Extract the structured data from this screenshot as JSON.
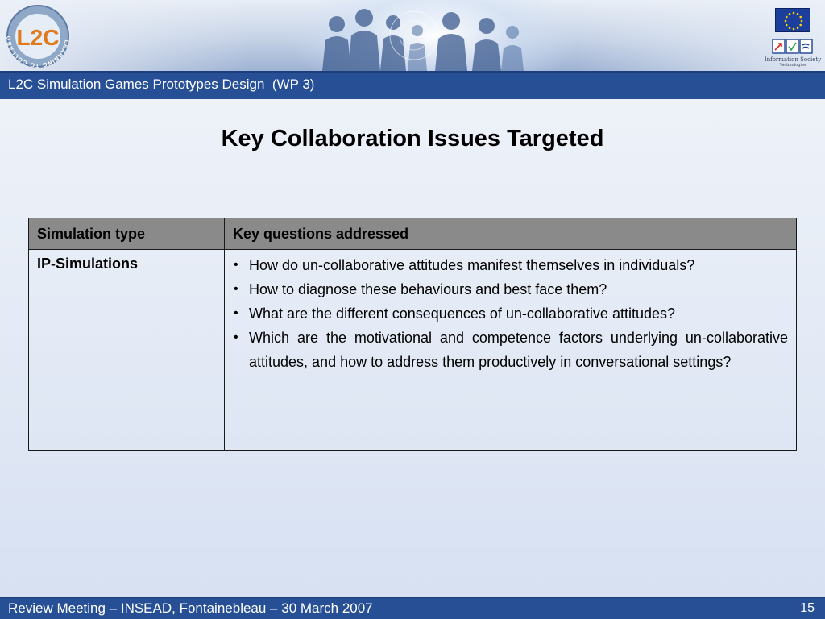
{
  "header": {
    "logo_text": "L2C",
    "logo_ring_text": "LEARNING TO COLLABORATE",
    "eu_caption": "Information Society",
    "eu_subcaption": "Technologies"
  },
  "title_bar": {
    "text": "L2C Simulation Games Prototypes Design  (WP 3)"
  },
  "slide": {
    "heading": "Key Collaboration Issues Targeted"
  },
  "table": {
    "headers": [
      "Simulation type",
      "Key questions addressed"
    ],
    "row": {
      "type": "IP-Simulations",
      "questions": [
        "How do un-collaborative attitudes manifest themselves in individuals?",
        "How to diagnose these behaviours and best face them?",
        "What are the different consequences of un-collaborative attitudes?",
        "Which are the motivational and competence factors underlying un-collaborative attitudes, and how to address them productively in conversational settings?"
      ]
    }
  },
  "footer": {
    "text": "Review Meeting – INSEAD, Fontainebleau – 30 March 2007",
    "page_number": "15"
  },
  "colors": {
    "bar_blue": "#264f96",
    "table_header_gray": "#8a8a8a",
    "eu_flag_blue": "#1c3f9c",
    "eu_star_yellow": "#ffd200"
  }
}
